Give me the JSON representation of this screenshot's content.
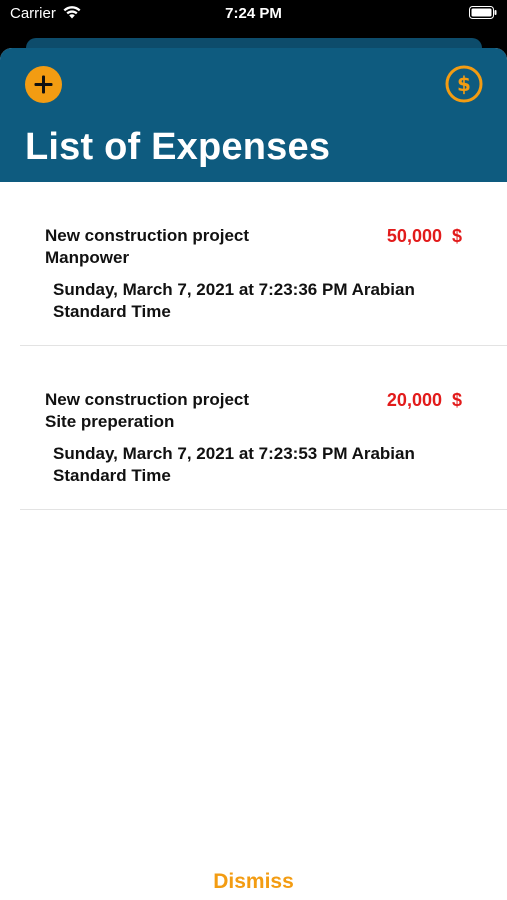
{
  "status_bar": {
    "carrier": "Carrier",
    "time": "7:24 PM"
  },
  "header": {
    "title": "List of Expenses",
    "add_icon": "plus-circle-icon",
    "dollar_icon": "dollar-circle-icon",
    "background_color": "#0e5b7f",
    "accent_color": "#f39c12"
  },
  "expenses": [
    {
      "title_line1": "New construction project",
      "title_line2": "Manpower",
      "amount": "50,000  $",
      "date_line1": "Sunday, March 7, 2021 at 7:23:36 PM Arabian",
      "date_line2": "Standard Time"
    },
    {
      "title_line1": "New construction project",
      "title_line2": "Site preperation",
      "amount": "20,000  $",
      "date_line1": "Sunday, March 7, 2021 at 7:23:53 PM Arabian",
      "date_line2": "Standard Time"
    }
  ],
  "amount_color": "#e21b1b",
  "dismiss_label": "Dismiss"
}
